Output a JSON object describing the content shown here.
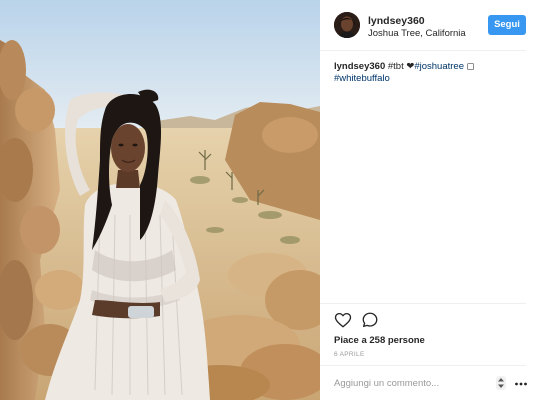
{
  "post": {
    "username": "lyndsey360",
    "location": "Joshua Tree, California",
    "follow_label": "Segui",
    "caption": {
      "user": "lyndsey360",
      "text_before": "#tbt ",
      "heart": "❤",
      "tag1": "#joshuatree",
      "emoji": " ◻",
      "tag2": "#whitebuffalo"
    },
    "likes": "Piace a 258 persone",
    "date": "6 APRILE",
    "comment_placeholder": "Aggiungi un commento...",
    "icons": {
      "like": "heart-outline-icon",
      "comment": "speech-bubble-icon",
      "sort": "updown-arrows-icon",
      "more": "ellipsis-icon"
    }
  },
  "colors": {
    "follow_button": "#3897f0",
    "hashtag": "#003569",
    "muted": "#999999"
  }
}
